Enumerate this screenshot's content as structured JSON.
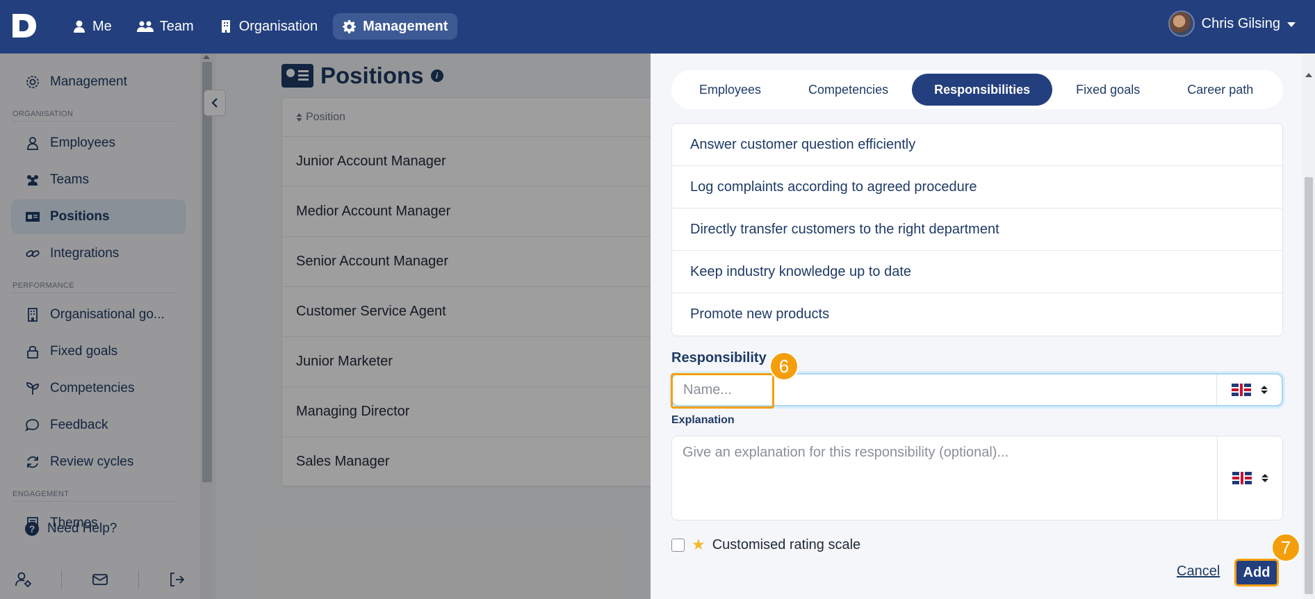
{
  "app": {
    "brand_letter": "D"
  },
  "nav": {
    "items": [
      {
        "label": "Me"
      },
      {
        "label": "Team"
      },
      {
        "label": "Organisation"
      },
      {
        "label": "Management"
      }
    ]
  },
  "user": {
    "name": "Chris Gilsing"
  },
  "sidebar": {
    "top_item": "Management",
    "sections": [
      {
        "title": "ORGANISATION",
        "items": [
          "Employees",
          "Teams",
          "Positions",
          "Integrations"
        ]
      },
      {
        "title": "PERFORMANCE",
        "items": [
          "Organisational go...",
          "Fixed goals",
          "Competencies",
          "Feedback",
          "Review cycles"
        ]
      },
      {
        "title": "ENGAGEMENT",
        "items": [
          "Themes"
        ]
      }
    ],
    "help": "Need Help?",
    "help_symbol": "?"
  },
  "main": {
    "title": "Positions",
    "info_symbol": "i",
    "column_header": "Position",
    "rows": [
      "Junior Account Manager",
      "Medior Account Manager",
      "Senior Account Manager",
      "Customer Service Agent",
      "Junior Marketer",
      "Managing Director",
      "Sales Manager"
    ]
  },
  "drawer": {
    "tabs": [
      "Employees",
      "Competencies",
      "Responsibilities",
      "Fixed goals",
      "Career path"
    ],
    "active_tab": "Responsibilities",
    "responsibilities": [
      "Answer customer question efficiently",
      "Log complaints according to agreed procedure",
      "Directly transfer customers to the right department",
      "Keep industry knowledge up to date",
      "Promote new products"
    ],
    "form": {
      "responsibility_label": "Responsibility",
      "name_placeholder": "Name...",
      "name_value": "",
      "explanation_label": "Explanation",
      "explanation_placeholder": "Give an explanation for this responsibility (optional)...",
      "checkbox_label": "Customised rating scale",
      "checkbox_checked": false,
      "cancel_label": "Cancel",
      "add_label": "Add"
    }
  },
  "annotations": {
    "step_a": "6",
    "step_b": "7",
    "highlight_color": "#f59e0b"
  },
  "colors": {
    "primary": "#233f7e",
    "text": "#1e3a66"
  }
}
